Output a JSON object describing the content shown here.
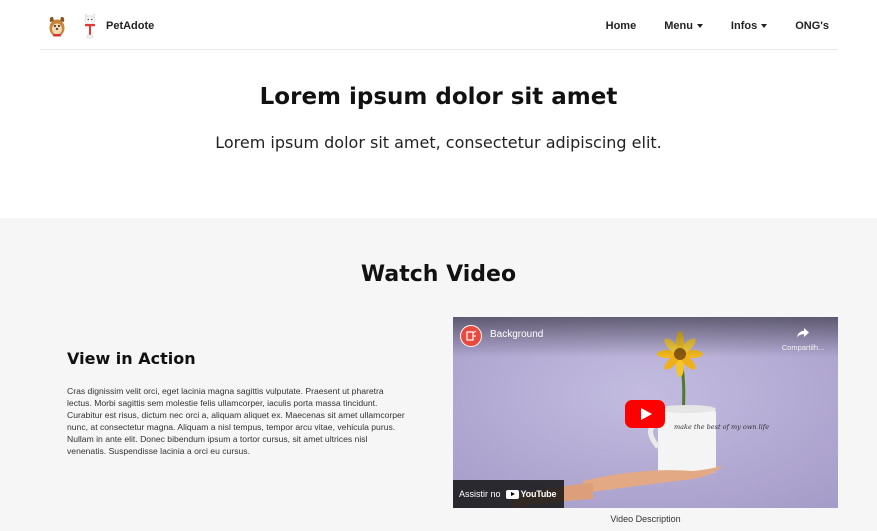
{
  "navbar": {
    "brand": "PetAdote",
    "items": [
      {
        "label": "Home",
        "dropdown": false
      },
      {
        "label": "Menu",
        "dropdown": true
      },
      {
        "label": "Infos",
        "dropdown": true
      },
      {
        "label": "ONG's",
        "dropdown": false
      }
    ]
  },
  "hero": {
    "title": "Lorem ipsum dolor sit amet",
    "subtitle": "Lorem ipsum dolor sit amet, consectetur adipiscing elit."
  },
  "video_section": {
    "title": "Watch Video",
    "view_title": "View in Action",
    "view_text": "Cras dignissim velit orci, eget lacinia magna sagittis vulputate. Praesent ut pharetra lectus. Morbi sagittis sem molestie felis ullamcorper, iaculis porta massa tincidunt. Curabitur est risus, dictum nec orci a, aliquam aliquet ex. Maecenas sit amet ullamcorper nunc, at consectetur magna. Aliquam a nisl tempus, tempor arcu vitae, vehicula purus. Nullam in ante elit. Donec bibendum ipsum a tortor cursus, sit amet ultrices nisl venenatis. Suspendisse lacinia a orci eu cursus.",
    "video": {
      "title": "Background",
      "share_label": "Compartilh...",
      "watch_on": "Assistir no",
      "platform": "YouTube",
      "mug_text": "make the best of my own life",
      "caption": "Video Description"
    }
  },
  "colors": {
    "accent_red": "#ff0000",
    "section_bg": "#f6f6f6",
    "video_bg": "#b4abd4"
  }
}
